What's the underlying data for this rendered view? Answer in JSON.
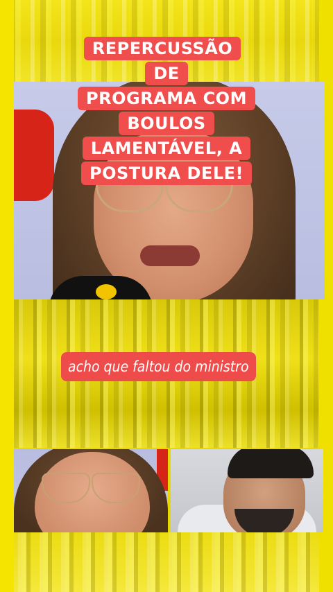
{
  "headline": {
    "lines": [
      "REPERCUSSÃO DE",
      "PROGRAMA COM",
      "BOULOS",
      "LAMENTÁVEL, A",
      "POSTURA DELE!"
    ]
  },
  "subtitle": {
    "text": "acho que faltou do ministro"
  },
  "colors": {
    "background_yellow": "#e6d800",
    "caption_red": "#f04d4d",
    "text_white": "#ffffff"
  }
}
